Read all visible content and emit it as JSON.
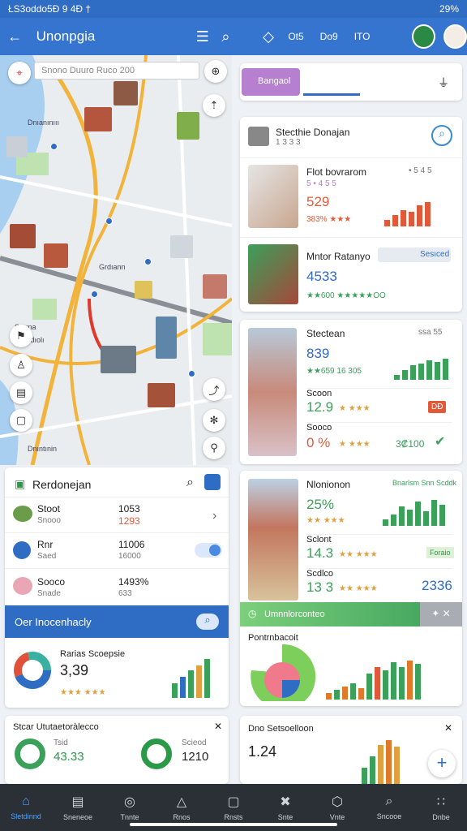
{
  "status": {
    "time": "ŁS3oddo5Đ 9 4Đ †",
    "battery": "29%"
  },
  "appbar": {
    "title": "Unonpgia",
    "tab1": "Ot5",
    "tab2": "Do9",
    "tab3": "ITO"
  },
  "map": {
    "search_placeholder": "Snono Duuro  Ruco 200"
  },
  "map_labels": {
    "l1": "Dnıanınııı",
    "l2": "Rndıolı",
    "l3": "Srnına",
    "l4": "Dnıntınin",
    "l5": "Grdıann"
  },
  "search_card": {
    "title": "Bangaol"
  },
  "listing_card": {
    "title": "Stecthie Donajan",
    "subtitle": "1 3 3 3",
    "items": [
      {
        "name": "Flot bovrarom",
        "meta": "5 • 4 5 5",
        "value": "529",
        "stat": "383% ★★★",
        "right": "• 5 4 5"
      },
      {
        "name": "Mntor Ratanyo",
        "meta": "Sesıced",
        "value": "4533",
        "stat": "★★600 ★★★★★OO"
      }
    ]
  },
  "mid_card": {
    "title": "Stectean",
    "right": "ssa 55",
    "items": [
      {
        "value": "839",
        "stat": "★★659 16 305",
        "label": ""
      },
      {
        "name": "Scoon",
        "value": "12.9",
        "stat": "★ ★★★",
        "badge": "DĐ"
      },
      {
        "name": "Sooco",
        "value": "0 %",
        "stat": "★ ★★★",
        "extra": "3₡100"
      }
    ]
  },
  "rank_card": {
    "title": "Nlonionon",
    "tag": "Bnarlsm Snn Scddk",
    "items": [
      {
        "value": "25%",
        "stat": "★★ ★★★"
      },
      {
        "name": "Sclont",
        "value": "14.3",
        "stat": "★★ ★★★",
        "badge": "Foraio"
      },
      {
        "name": "Scdlco",
        "value": "13 3",
        "stat": "★★ ★★★",
        "right": "2336"
      }
    ],
    "banner": "Umnnlorconteo",
    "chart_title": "Pontrnbacoit"
  },
  "list_panel": {
    "title": "Rerdonejan",
    "rows": [
      {
        "name": "Stoot",
        "meta": "Snooo",
        "v1": "1053",
        "v2": "1293"
      },
      {
        "name": "Rnr",
        "meta": "Saed",
        "v1": "11006",
        "v2": "16000"
      },
      {
        "name": "Sooco",
        "meta": "Snade",
        "v1": "1493%",
        "v2": "633"
      }
    ],
    "banner": "Oer Inocenhacly",
    "summary_title": "Rarias Scoepsie",
    "summary_value": "3,39",
    "summary_stat": "★★★ ★★★"
  },
  "bottom_left": {
    "title": "Stcar Ututaetoràlecco",
    "v1": "43.33",
    "v2": "1210",
    "l1": "Tsid",
    "l2": "Scieod"
  },
  "bottom_right": {
    "title": "Dno Setsoelloon",
    "value": "1.24"
  },
  "nav": [
    {
      "label": "Sletdinnd",
      "icon": "⌂",
      "active": true
    },
    {
      "label": "Sneneoe",
      "icon": "▤"
    },
    {
      "label": "Tnnte",
      "icon": "◎"
    },
    {
      "label": "Rnos",
      "icon": "△"
    },
    {
      "label": "Rnsts",
      "icon": "▢"
    },
    {
      "label": "Snte",
      "icon": "✖"
    },
    {
      "label": "Vnte",
      "icon": "⬡"
    },
    {
      "label": "Sncooe",
      "icon": "⌕"
    },
    {
      "label": "Dnbe",
      "icon": "∷"
    }
  ]
}
